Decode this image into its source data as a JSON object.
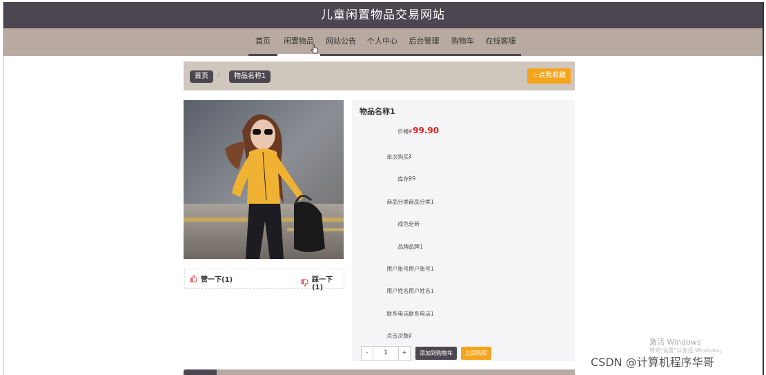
{
  "site": {
    "title": "儿童闲置物品交易网站"
  },
  "nav": {
    "items": [
      {
        "label": "首页",
        "width": 42
      },
      {
        "label": "闲置物品",
        "width": 62,
        "active": true
      },
      {
        "label": "网站公告",
        "width": 60
      },
      {
        "label": "个人中心",
        "width": 60
      },
      {
        "label": "后台管理",
        "width": 61
      },
      {
        "label": "购物车",
        "width": 51
      },
      {
        "label": "在线客服",
        "width": 59
      }
    ]
  },
  "breadcrumb": {
    "home": "首页",
    "separator": "/",
    "current": "物品名称1"
  },
  "favorite_label": "☆点我收藏",
  "likes": {
    "up": "赞一下(1)",
    "down": "踩一下(1)"
  },
  "product": {
    "name": "物品名称1",
    "price_label": "价格:",
    "currency": "¥",
    "price": "99.90",
    "fields": [
      {
        "label": "单次购买:",
        "value": "1"
      },
      {
        "label": "库存:",
        "value": "99"
      },
      {
        "label": "商品分类:",
        "value": "商品分类1"
      },
      {
        "label": "成色:",
        "value": "全新"
      },
      {
        "label": "品牌:",
        "value": "品牌1"
      },
      {
        "label": "用户账号:",
        "value": "用户账号1"
      },
      {
        "label": "用户姓名:",
        "value": "用户姓名1"
      },
      {
        "label": "联系电话:",
        "value": "联系电话1"
      },
      {
        "label": "点击次数:",
        "value": "2"
      }
    ]
  },
  "purchase": {
    "minus": "-",
    "quantity": "1",
    "plus": "+",
    "add_to_cart": "添加到购物车",
    "buy_now": "立即购买"
  },
  "os_overlay": {
    "activate": "激活 Windows",
    "activate_sub": "转到\"设置\"以激活 Windows。"
  },
  "watermark": "CSDN @计算机程序华哥",
  "colors": {
    "header": "#4c4650",
    "navbar": "#b8aaa0",
    "accent": "#f4a51c",
    "price": "#e02020"
  }
}
